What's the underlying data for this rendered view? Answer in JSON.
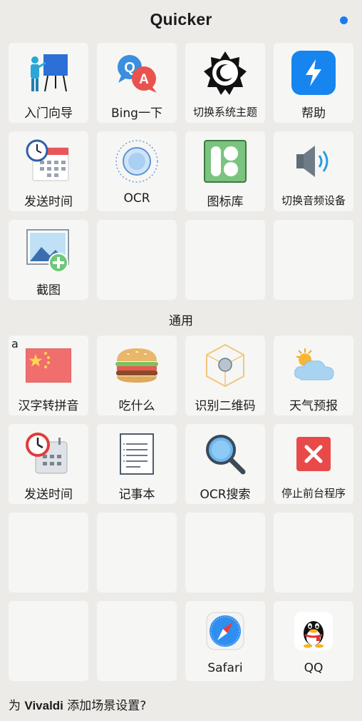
{
  "window": {
    "title": "Quicker"
  },
  "scene_grid": [
    {
      "label": "入门向导",
      "icon": "presentation-board-icon"
    },
    {
      "label": "Bing一下",
      "icon": "qa-bubbles-icon"
    },
    {
      "label": "切换系统主题",
      "icon": "moon-gear-icon"
    },
    {
      "label": "帮助",
      "icon": "lightning-app-icon"
    },
    {
      "label": "发送时间",
      "icon": "calendar-clock-icon"
    },
    {
      "label": "OCR",
      "icon": "ocr-circle-icon"
    },
    {
      "label": "图标库",
      "icon": "icon-library-icon"
    },
    {
      "label": "切换音频设备",
      "icon": "speaker-icon"
    },
    {
      "label": "截图",
      "icon": "image-add-icon"
    }
  ],
  "section_title": "通用",
  "general_grid": [
    {
      "label": "汉字转拼音",
      "icon": "china-flag-icon",
      "corner": "a"
    },
    {
      "label": "吃什么",
      "icon": "burger-icon"
    },
    {
      "label": "识别二维码",
      "icon": "cube-icon"
    },
    {
      "label": "天气预报",
      "icon": "weather-icon"
    },
    {
      "label": "发送时间",
      "icon": "alarm-calendar-icon"
    },
    {
      "label": "记事本",
      "icon": "notepad-icon"
    },
    {
      "label": "OCR搜索",
      "icon": "magnifier-icon"
    },
    {
      "label": "停止前台程序",
      "icon": "close-red-icon"
    },
    {
      "label": "Safari",
      "icon": "safari-compass-icon"
    },
    {
      "label": "QQ",
      "icon": "qq-penguin-icon"
    }
  ],
  "footer": {
    "prefix": "为 ",
    "app": "Vivaldi",
    "suffix": " 添加场景设置?"
  },
  "colors": {
    "accent": "#1a7cf0",
    "background": "#ecebe8",
    "tile": "#f6f6f5"
  }
}
